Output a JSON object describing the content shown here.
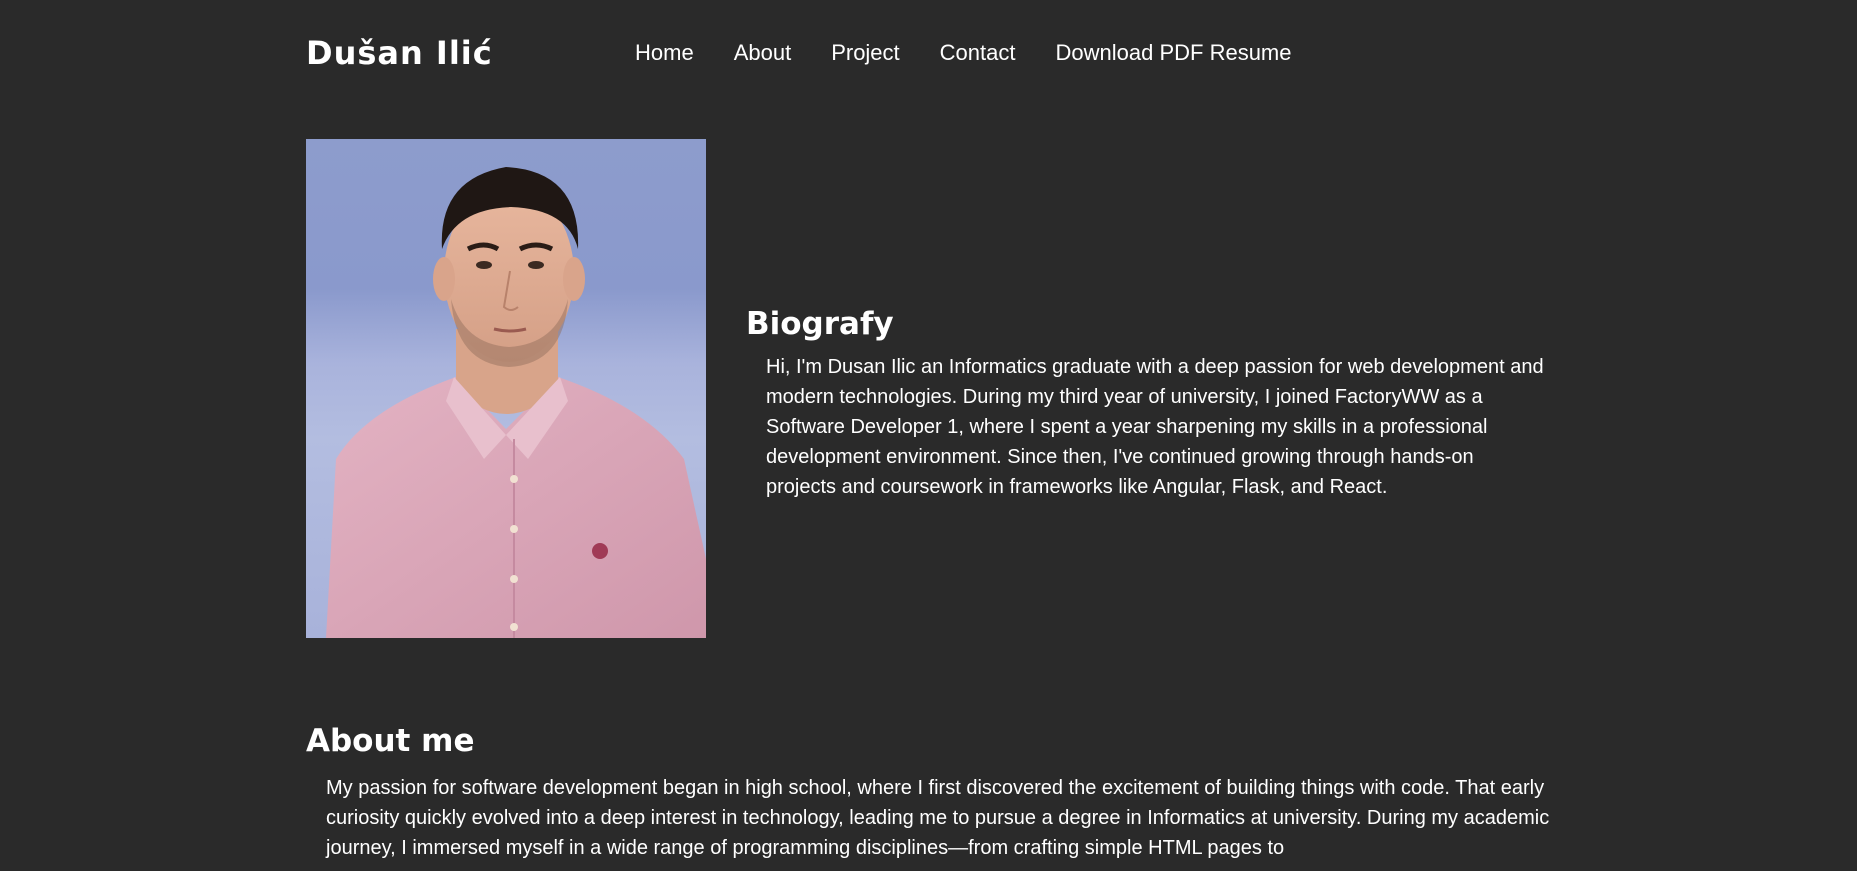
{
  "header": {
    "brand": "Dušan Ilić",
    "nav": [
      {
        "label": "Home"
      },
      {
        "label": "About"
      },
      {
        "label": "Project"
      },
      {
        "label": "Contact"
      },
      {
        "label": "Download PDF Resume"
      }
    ]
  },
  "portrait": {
    "icon": "profile-photo",
    "background_color": "#8d9ccc",
    "shirt_color": "#d9a7b8"
  },
  "biography": {
    "heading": "Biografy",
    "text": "Hi, I'm Dusan Ilic an Informatics graduate with a deep passion for web development and modern technologies. During my third year of university, I joined FactoryWW as a Software Developer 1, where I spent a year sharpening my skills in a professional development environment. Since then, I've continued growing through hands-on projects and coursework in frameworks like Angular, Flask, and React."
  },
  "about": {
    "heading": "About me",
    "text": "My passion for software development began in high school, where I first discovered the excitement of building things with code. That early curiosity quickly evolved into a deep interest in technology, leading me to pursue a degree in Informatics at university. During my academic journey, I immersed myself in a wide range of programming disciplines—from crafting simple HTML pages to"
  },
  "colors": {
    "page_background": "#2a2a2a",
    "text": "#ffffff"
  }
}
